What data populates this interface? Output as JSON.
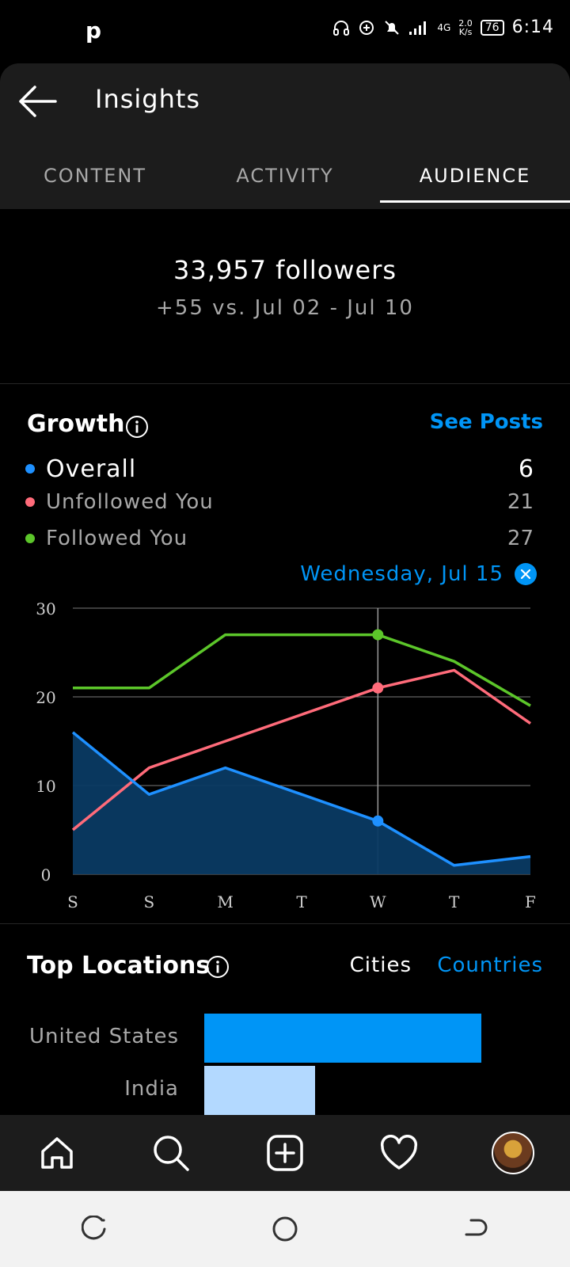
{
  "status_bar": {
    "logo": "p",
    "network": "4G",
    "speed_value": "2.0",
    "speed_unit": "K/s",
    "battery": "76",
    "time": "6:14"
  },
  "header": {
    "title": "Insights"
  },
  "tabs": [
    {
      "label": "CONTENT"
    },
    {
      "label": "ACTIVITY"
    },
    {
      "label": "AUDIENCE",
      "active": true
    }
  ],
  "followers": {
    "count_text": "33,957 followers",
    "delta_text": "+55 vs. Jul 02 - Jul 10"
  },
  "growth": {
    "title": "Growth",
    "see_posts": "See Posts",
    "legend": [
      {
        "label": "Overall",
        "value": "6",
        "color": "#1e90ff"
      },
      {
        "label": "Unfollowed You",
        "value": "21",
        "color": "#ff6b7a"
      },
      {
        "label": "Followed You",
        "value": "27",
        "color": "#5cc62a"
      }
    ],
    "selected_date": "Wednesday, Jul 15"
  },
  "chart_data": {
    "type": "line",
    "categories": [
      "S",
      "S",
      "M",
      "T",
      "W",
      "T",
      "F"
    ],
    "series": [
      {
        "name": "Overall",
        "values": [
          16,
          9,
          12,
          9,
          6,
          1,
          2
        ],
        "color": "#1e90ff",
        "area": true
      },
      {
        "name": "Unfollowed You",
        "values": [
          5,
          12,
          15,
          18,
          21,
          23,
          17
        ],
        "color": "#ff6b7a"
      },
      {
        "name": "Followed You",
        "values": [
          21,
          21,
          27,
          27,
          27,
          24,
          19
        ],
        "color": "#5cc62a"
      }
    ],
    "ylim": [
      0,
      30
    ],
    "yticks": [
      0,
      10,
      20,
      30
    ],
    "grid": true,
    "highlight_index": 4
  },
  "locations": {
    "title": "Top Locations",
    "cities_label": "Cities",
    "countries_label": "Countries",
    "rows": [
      {
        "name": "United States",
        "share": 1.0,
        "color": "#0095f6"
      },
      {
        "name": "India",
        "share": 0.4,
        "color": "#b3d9ff"
      }
    ]
  },
  "icons": {
    "back": "arrow-left-icon",
    "info": "info-icon",
    "close": "close-icon",
    "home": "home-icon",
    "search": "search-icon",
    "create": "plus-square-icon",
    "activity": "heart-icon",
    "profile": "avatar"
  }
}
